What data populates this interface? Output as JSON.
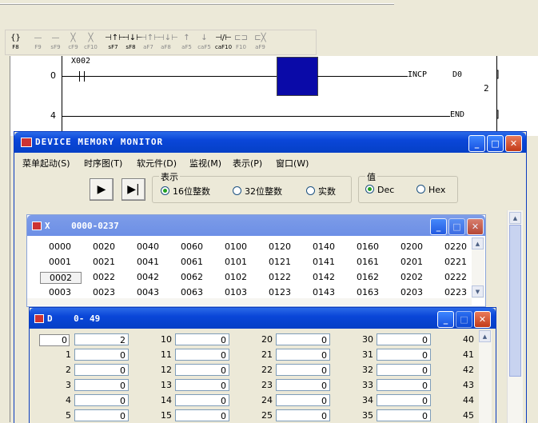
{
  "toolbar": {
    "buttons": [
      {
        "glyph": "{}",
        "key": "F8",
        "enabled": true
      },
      {
        "glyph": "—",
        "key": "F9",
        "enabled": false
      },
      {
        "glyph": "—",
        "key": "sF9",
        "enabled": false
      },
      {
        "glyph": "╳",
        "key": "cF9",
        "enabled": false
      },
      {
        "glyph": "╳",
        "key": "cF10",
        "enabled": false
      },
      {
        "glyph": "⊣↑⊢",
        "key": "sF7",
        "enabled": true
      },
      {
        "glyph": "⊣↓⊢",
        "key": "sF8",
        "enabled": true
      },
      {
        "glyph": "⊣↑⊢",
        "key": "aF7",
        "enabled": false
      },
      {
        "glyph": "⊣↓⊢",
        "key": "aF8",
        "enabled": false
      },
      {
        "glyph": "↑",
        "key": "aF5",
        "enabled": false
      },
      {
        "glyph": "↓",
        "key": "caF5",
        "enabled": false
      },
      {
        "glyph": "⊣/⊢",
        "key": "caF10",
        "enabled": true
      },
      {
        "glyph": "⊏⊐",
        "key": "F10",
        "enabled": false
      },
      {
        "glyph": "⊏╳",
        "key": "aF9",
        "enabled": false
      }
    ]
  },
  "ladder": {
    "rungs": [
      {
        "step": "0",
        "contact": "X002",
        "instruction": "INCP",
        "operand": "D0",
        "operand2": "2"
      },
      {
        "step": "4",
        "instruction": "END"
      }
    ]
  },
  "monitor": {
    "title": "DEVICE MEMORY MONITOR",
    "menu": [
      "菜单起动(S)",
      "时序图(T)",
      "软元件(D)",
      "监视(M)",
      "表示(P)",
      "窗口(W)"
    ],
    "display_group": "表示",
    "display_options": [
      "16位整数",
      "32位整数",
      "实数"
    ],
    "display_selected": 0,
    "value_group": "值",
    "value_options": [
      "Dec",
      "Hex"
    ],
    "value_selected": 0
  },
  "xwin": {
    "title": "X    0000-0237",
    "rows": [
      [
        "0000",
        "0020",
        "0040",
        "0060",
        "0100",
        "0120",
        "0140",
        "0160",
        "0200",
        "0220"
      ],
      [
        "0001",
        "0021",
        "0041",
        "0061",
        "0101",
        "0121",
        "0141",
        "0161",
        "0201",
        "0221"
      ],
      [
        "0002",
        "0022",
        "0042",
        "0062",
        "0102",
        "0122",
        "0142",
        "0162",
        "0202",
        "0222"
      ],
      [
        "0003",
        "0023",
        "0043",
        "0063",
        "0103",
        "0123",
        "0143",
        "0163",
        "0203",
        "0223"
      ]
    ]
  },
  "dwin": {
    "title": "D    0- 49",
    "rows": [
      [
        {
          "n": "0",
          "v": "2"
        },
        {
          "n": "10",
          "v": "0"
        },
        {
          "n": "20",
          "v": "0"
        },
        {
          "n": "30",
          "v": "0"
        },
        {
          "n": "40",
          "v": ""
        }
      ],
      [
        {
          "n": "1",
          "v": "0"
        },
        {
          "n": "11",
          "v": "0"
        },
        {
          "n": "21",
          "v": "0"
        },
        {
          "n": "31",
          "v": "0"
        },
        {
          "n": "41",
          "v": ""
        }
      ],
      [
        {
          "n": "2",
          "v": "0"
        },
        {
          "n": "12",
          "v": "0"
        },
        {
          "n": "22",
          "v": "0"
        },
        {
          "n": "32",
          "v": "0"
        },
        {
          "n": "42",
          "v": ""
        }
      ],
      [
        {
          "n": "3",
          "v": "0"
        },
        {
          "n": "13",
          "v": "0"
        },
        {
          "n": "23",
          "v": "0"
        },
        {
          "n": "33",
          "v": "0"
        },
        {
          "n": "43",
          "v": ""
        }
      ],
      [
        {
          "n": "4",
          "v": "0"
        },
        {
          "n": "14",
          "v": "0"
        },
        {
          "n": "24",
          "v": "0"
        },
        {
          "n": "34",
          "v": "0"
        },
        {
          "n": "44",
          "v": ""
        }
      ],
      [
        {
          "n": "5",
          "v": "0"
        },
        {
          "n": "15",
          "v": "0"
        },
        {
          "n": "25",
          "v": "0"
        },
        {
          "n": "35",
          "v": "0"
        },
        {
          "n": "45",
          "v": ""
        }
      ]
    ]
  },
  "colors": {
    "titlebar": "#0a46d8",
    "cursor": "#0a0aa8",
    "close": "#c23a18"
  }
}
